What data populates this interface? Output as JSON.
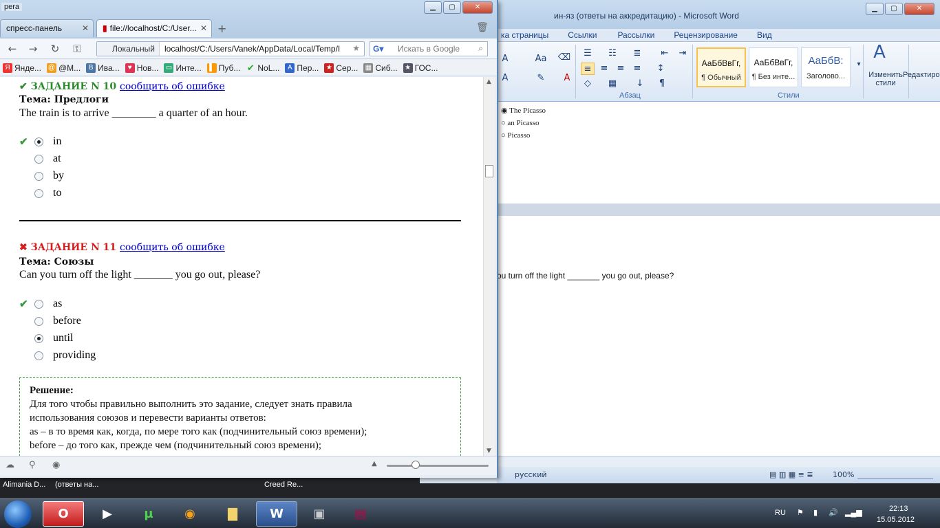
{
  "browser": {
    "title_fragment": "pera",
    "tabs": [
      {
        "label": "спресс-панель"
      },
      {
        "label": "file://localhost/C:/User..."
      }
    ],
    "address": {
      "location_label": "Локальный",
      "url": "localhost/C:/Users/Vanek/AppData/Local/Temp/I"
    },
    "search_placeholder": "Искать в Google",
    "bookmarks": [
      {
        "label": "Янде...",
        "icon": "yandex-icon",
        "color": "#e33"
      },
      {
        "label": "@M...",
        "icon": "mail-icon",
        "color": "#f0a020"
      },
      {
        "label": "Ива...",
        "icon": "vk-icon",
        "color": "#4a76a8"
      },
      {
        "label": "Нов...",
        "icon": "heart-icon",
        "color": "#d35"
      },
      {
        "label": "Инте...",
        "icon": "tv-icon",
        "color": "#3a7"
      },
      {
        "label": "Пуб...",
        "icon": "pub-icon",
        "color": "#f90"
      },
      {
        "label": "NoL...",
        "icon": "check-icon",
        "color": "#2a2"
      },
      {
        "label": "Пер...",
        "icon": "translate-icon",
        "color": "#36c"
      },
      {
        "label": "Сер...",
        "icon": "star-icon",
        "color": "#c22"
      },
      {
        "label": "Сиб...",
        "icon": "grid-icon",
        "color": "#888"
      },
      {
        "label": "ГОС...",
        "icon": "star-box-icon",
        "color": "#556"
      }
    ]
  },
  "tasks": [
    {
      "status": "correct",
      "mark": "✔",
      "title": "ЗАДАНИЕ N 10",
      "report_link": "сообщить об ошибке",
      "topic": "Тема: Предлоги",
      "question": "The train is to arrive ________ a quarter of an hour.",
      "options": [
        "in",
        "at",
        "by",
        "to"
      ],
      "selected": 0,
      "correct": 0
    },
    {
      "status": "wrong",
      "mark": "✖",
      "title": "ЗАДАНИЕ N 11",
      "report_link": "сообщить об ошибке",
      "topic": "Тема: Союзы",
      "question": "Can you turn off the light _______ you go out, please?",
      "options": [
        "as",
        "before",
        "until",
        "providing"
      ],
      "selected": 2,
      "correct": 0
    }
  ],
  "solution": {
    "heading": "Решение:",
    "lines": [
      "Для того чтобы правильно выполнить это задание, следует знать правила",
      "использования союзов и перевести варианты ответов:",
      "as – в то время как, когда, по мере того как (подчинительный союз времени);",
      "before – до того как, прежде чем (подчинительный союз времени);"
    ]
  },
  "word": {
    "title": "ин-яз (ответы на аккредитацию)  -  Microsoft Word",
    "tabs": [
      "ка страницы",
      "Ссылки",
      "Рассылки",
      "Рецензирование",
      "Вид"
    ],
    "groups": {
      "paragraph": "Абзац",
      "styles": "Стили",
      "change_styles": "Изменить стили",
      "editing": "Редактиро"
    },
    "styles": [
      {
        "preview": "АаБбВвГг,",
        "name": "¶ Обычный"
      },
      {
        "preview": "АаБбВвГг,",
        "name": "¶ Без инте..."
      },
      {
        "preview": "АаБбВ:",
        "name": "Заголово..."
      }
    ],
    "doc_options": [
      "The Picasso",
      "an Picasso",
      "Picasso"
    ],
    "doc_question": "ou turn off the light _______ you go out, please?",
    "status_lang": "русский",
    "zoom": "100%"
  },
  "taskbar": {
    "top_items": [
      "Alimania D...",
      "(ответы на...",
      "Creed Re..."
    ],
    "lang": "RU",
    "time": "22:13",
    "date": "15.05.2012"
  }
}
